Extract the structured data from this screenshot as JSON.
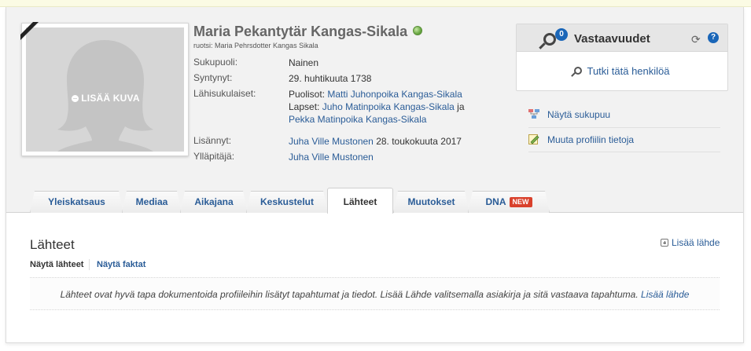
{
  "profile": {
    "name": "Maria Pekantytär Kangas-Sikala",
    "alt_name": "ruotsi: Maria Pehrsdotter Kangas Sikala",
    "add_photo_label": "LISÄÄ KUVA",
    "gender_label": "Sukupuoli:",
    "gender_value": "Nainen",
    "born_label": "Syntynyt:",
    "born_value": "29. huhtikuuta 1738",
    "relatives_label": "Lähisukulaiset:",
    "spouses_prefix": "Puolisot:",
    "spouse_1": "Matti Juhonpoika Kangas-Sikala",
    "children_prefix": "Lapset:",
    "child_1": "Juho Matinpoika Kangas-Sikala",
    "and_word": "ja",
    "child_2": "Pekka Matinpoika Kangas-Sikala",
    "added_by_label": "Lisännyt:",
    "added_by_name": "Juha Ville Mustonen",
    "added_date": "28. toukokuuta 2017",
    "manager_label": "Ylläpitäjä:",
    "manager_name": "Juha Ville Mustonen"
  },
  "answers": {
    "count": "0",
    "title": "Vastaavuudet",
    "help": "?",
    "research_link": "Tutki tätä henkilöä"
  },
  "side_links": {
    "family_tree": "Näytä sukupuu",
    "edit_profile": "Muuta profiilin tietoja"
  },
  "tabs": [
    {
      "label": "Yleiskatsaus"
    },
    {
      "label": "Mediaa"
    },
    {
      "label": "Aikajana"
    },
    {
      "label": "Keskustelut"
    },
    {
      "label": "Lähteet"
    },
    {
      "label": "Muutokset"
    },
    {
      "label": "DNA",
      "badge": "NEW"
    }
  ],
  "active_tab": "Lähteet",
  "sources": {
    "title": "Lähteet",
    "add_source": "Lisää lähde",
    "show_sources": "Näytä lähteet",
    "show_facts": "Näytä faktat",
    "info_text": "Lähteet ovat hyvä tapa dokumentoida profiileihin lisätyt tapahtumat ja tiedot. Lisää Lähde valitsemalla asiakirja ja sitä vastaava tapahtuma.",
    "info_link": "Lisää lähde"
  },
  "colors": {
    "link": "#2a5c97",
    "header_bg": "#f2f2f2",
    "badge_blue": "#1a66b8",
    "new_badge": "#d9412c"
  }
}
